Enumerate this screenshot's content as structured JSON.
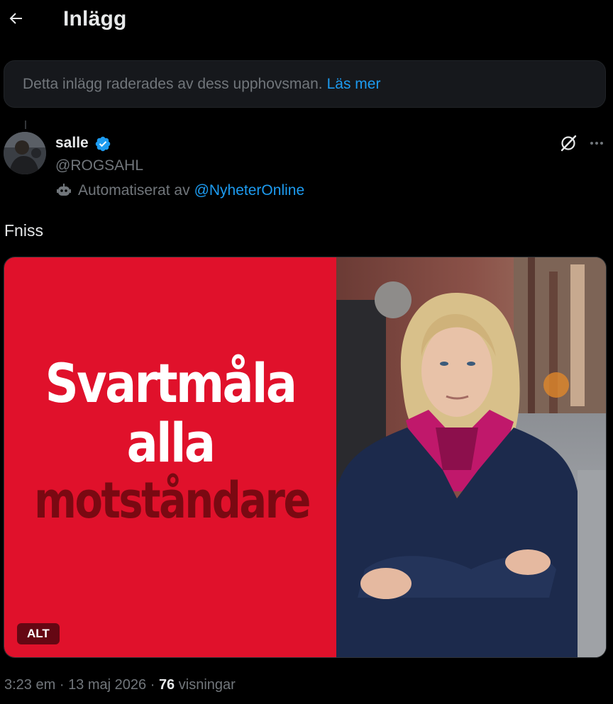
{
  "header": {
    "title": "Inlägg",
    "back_icon": "arrow-left-icon"
  },
  "notice": {
    "text": "Detta inlägg raderades av dess upphovsman.",
    "link": "Läs mer"
  },
  "author": {
    "name": "salle",
    "handle": "@ROGSAHL",
    "verified": true,
    "automated_label": "Automatiserat av",
    "automated_by": "@NyheterOnline"
  },
  "post": {
    "text": "Fniss",
    "image": {
      "slogan_line1": "Svartmåla",
      "slogan_line2": "alla",
      "slogan_line3": "motståndare",
      "alt_label": "ALT"
    }
  },
  "meta": {
    "time": "3:23 em",
    "separator": "·",
    "date": "13 maj 2026",
    "views_count": "76",
    "views_label": "visningar"
  },
  "colors": {
    "background": "#000000",
    "text": "#e7e9ea",
    "muted": "#71767b",
    "link": "#1d9bf0",
    "image_red": "#e0112b",
    "slogan_dark": "#7a0912"
  }
}
